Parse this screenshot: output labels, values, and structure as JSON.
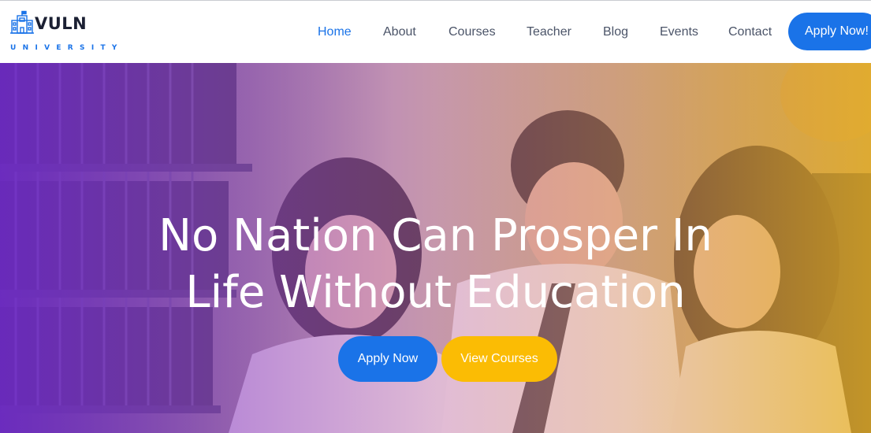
{
  "brand": {
    "name": "VULN",
    "subtitle": "UNIVERSITY",
    "icon": "university-building-icon"
  },
  "nav": {
    "items": [
      {
        "label": "Home",
        "active": true
      },
      {
        "label": "About",
        "active": false
      },
      {
        "label": "Courses",
        "active": false
      },
      {
        "label": "Teacher",
        "active": false
      },
      {
        "label": "Blog",
        "active": false
      },
      {
        "label": "Events",
        "active": false
      },
      {
        "label": "Contact",
        "active": false
      }
    ],
    "cta_label": "Apply Now!"
  },
  "hero": {
    "title_lines": [
      "No Nation Can Prosper In",
      "Life Without Education"
    ],
    "primary_button": "Apply Now",
    "secondary_button": "View Courses",
    "photo": "students-in-library-photo"
  },
  "colors": {
    "primary": "#1a73e8",
    "secondary": "#fbbc04",
    "nav_text": "#4b5468",
    "overlay_start": "#762ad6",
    "overlay_end": "#e8b028"
  }
}
